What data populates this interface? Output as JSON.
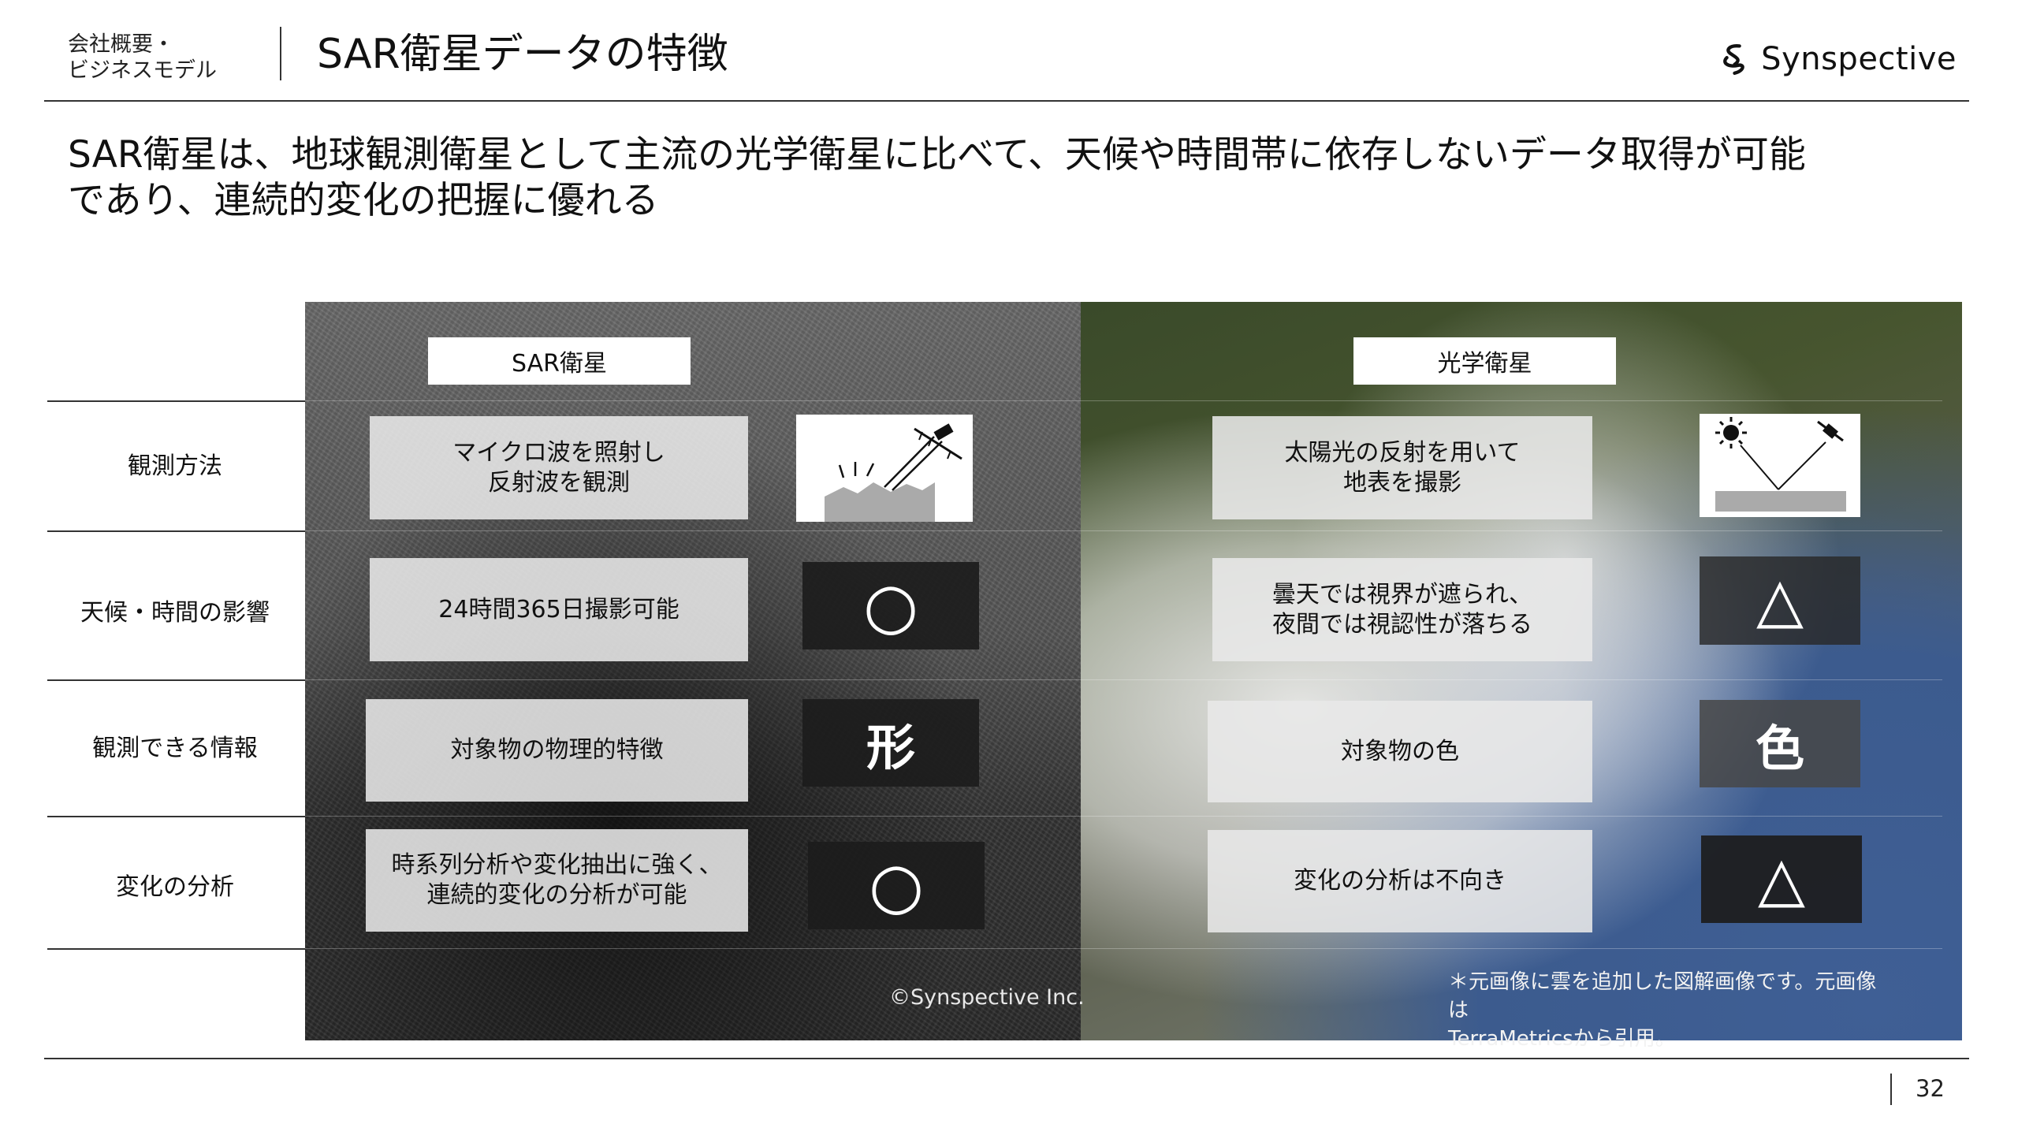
{
  "header": {
    "section_label_line1": "会社概要・",
    "section_label_line2": "ビジネスモデル",
    "title": "SAR衛星データの特徴",
    "brand": "Synspective"
  },
  "lead": {
    "line1": "SAR衛星は、地球観測衛星として主流の光学衛星に比べて、天候や時間帯に依存しないデータ取得が可能",
    "line2": "であり、連続的変化の把握に優れる"
  },
  "table": {
    "columns": [
      "SAR衛星",
      "光学衛星"
    ],
    "rows": [
      {
        "label": "観測方法",
        "sar_line1": "マイクロ波を照射し",
        "sar_line2": "反射波を観測",
        "sar_icon": "sar-observation-diagram-icon",
        "optical_line1": "太陽光の反射を用いて",
        "optical_line2": "地表を撮影",
        "optical_icon": "sunlight-reflection-diagram-icon"
      },
      {
        "label": "天候・時間の影響",
        "sar_line1": "24時間365日撮影可能",
        "sar_line2": "",
        "sar_mark": "○",
        "optical_line1": "曇天では視界が遮られ、",
        "optical_line2": "夜間では視認性が落ちる",
        "optical_mark": "△"
      },
      {
        "label": "観測できる情報",
        "sar_line1": "対象物の物理的特徴",
        "sar_line2": "",
        "sar_mark": "形",
        "optical_line1": "対象物の色",
        "optical_line2": "",
        "optical_mark": "色"
      },
      {
        "label": "変化の分析",
        "sar_line1": "時系列分析や変化抽出に強く、",
        "sar_line2": "連続的変化の分析が可能",
        "sar_mark": "○",
        "optical_line1": "変化の分析は不向き",
        "optical_line2": "",
        "optical_mark": "△"
      }
    ]
  },
  "credits": {
    "sar": "©Synspective Inc.",
    "optical_line1": "＊元画像に雲を追加した図解画像です。元画像は",
    "optical_line2": "TerraMetricsから引用。"
  },
  "footer": {
    "page_number": "32"
  },
  "colors": {
    "rule": "#333333",
    "cell_bg": "#e8e8e8",
    "mark_box": "#1c1c1c"
  }
}
